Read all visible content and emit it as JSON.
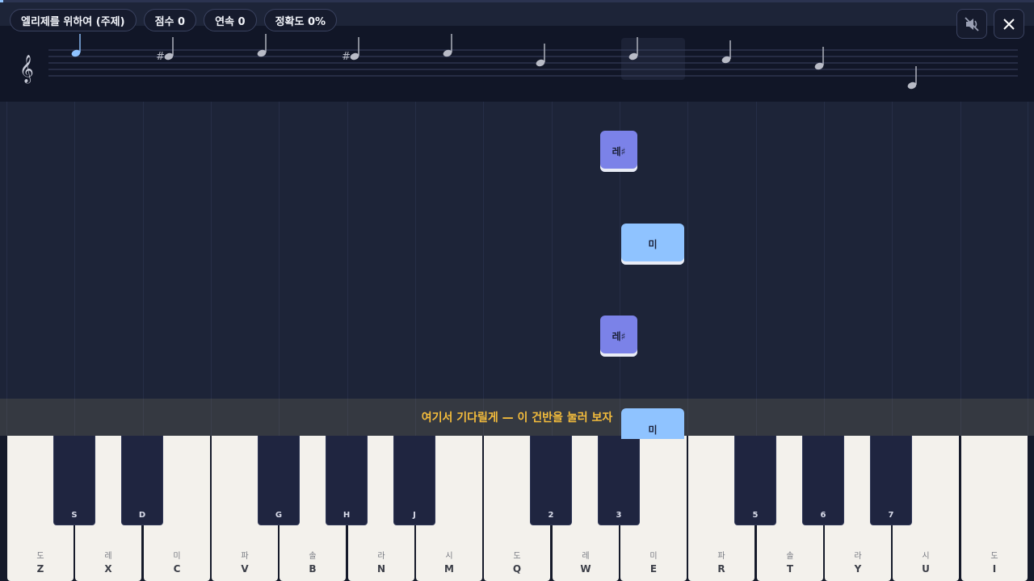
{
  "stats": {
    "song": "엘리제를 위하여 (주제)",
    "score": "점수 0",
    "streak": "연속 0",
    "accuracy": "정확도 0%"
  },
  "controls": {
    "mute_icon": "speaker-muted-icon",
    "close_icon": "close-icon"
  },
  "staff": {
    "clef_icon": "treble-clef-icon",
    "clef_glyph": "𝄞",
    "notes": [
      {
        "sharp": false,
        "state": "active"
      },
      {
        "sharp": true,
        "state": "upcoming"
      },
      {
        "sharp": false,
        "state": "upcoming"
      },
      {
        "sharp": true,
        "state": "upcoming"
      },
      {
        "sharp": false,
        "state": "upcoming"
      },
      {
        "sharp": false,
        "state": "upcoming"
      },
      {
        "sharp": false,
        "state": "upcoming"
      },
      {
        "sharp": false,
        "state": "upcoming"
      },
      {
        "sharp": false,
        "state": "upcoming"
      },
      {
        "sharp": false,
        "state": "upcoming"
      }
    ]
  },
  "falling_notes": [
    {
      "label": "레♯",
      "kind": "sharp"
    },
    {
      "label": "미",
      "kind": "natural"
    },
    {
      "label": "레♯",
      "kind": "sharp"
    },
    {
      "label": "미",
      "kind": "natural"
    }
  ],
  "hint": "여기서 기다릴게 — 이 건반을 눌러 보자",
  "keyboard": {
    "white_keys": [
      {
        "note": "도",
        "key": "Z"
      },
      {
        "note": "레",
        "key": "X"
      },
      {
        "note": "미",
        "key": "C"
      },
      {
        "note": "파",
        "key": "V"
      },
      {
        "note": "솔",
        "key": "B"
      },
      {
        "note": "라",
        "key": "N"
      },
      {
        "note": "시",
        "key": "M"
      },
      {
        "note": "도",
        "key": "Q"
      },
      {
        "note": "레",
        "key": "W"
      },
      {
        "note": "미",
        "key": "E"
      },
      {
        "note": "파",
        "key": "R"
      },
      {
        "note": "솔",
        "key": "T"
      },
      {
        "note": "라",
        "key": "Y"
      },
      {
        "note": "시",
        "key": "U"
      },
      {
        "note": "도",
        "key": "I"
      }
    ],
    "black_keys": [
      {
        "key": "S"
      },
      {
        "key": "D"
      },
      {
        "key": "G"
      },
      {
        "key": "H"
      },
      {
        "key": "J"
      },
      {
        "key": "2"
      },
      {
        "key": "3"
      },
      {
        "key": "5"
      },
      {
        "key": "6"
      },
      {
        "key": "7"
      }
    ]
  },
  "colors": {
    "background": "#1d2438",
    "accent_sharp": "#7b82e8",
    "accent_natural": "#8fc3ff",
    "hint_text": "#f5bd3c"
  }
}
